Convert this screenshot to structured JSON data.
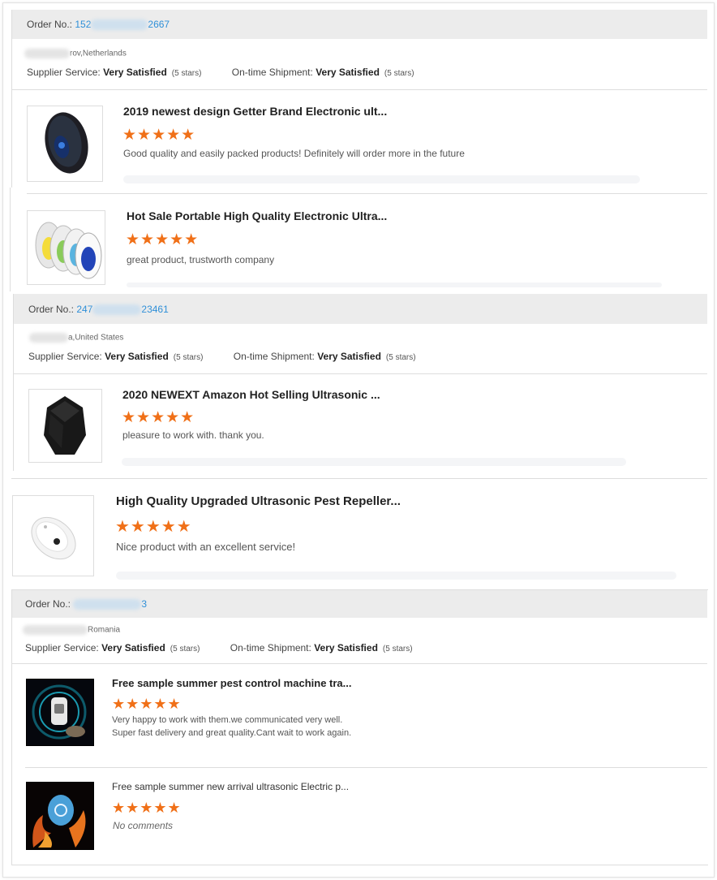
{
  "orders": [
    {
      "order_label": "Order No.:",
      "order_prefix": "152",
      "order_suffix": "2667",
      "location": "rov,Netherlands",
      "supplier_label": "Supplier Service:",
      "supplier_value": "Very Satisfied",
      "supplier_stars": "(5 stars)",
      "shipment_label": "On-time Shipment:",
      "shipment_value": "Very Satisfied",
      "shipment_stars": "(5 stars)",
      "products": [
        {
          "title": "2019 newest design Getter Brand Electronic ult...",
          "stars": "★★★★★",
          "comment": "Good quality and easily packed products! Definitely will order more in the future"
        },
        {
          "title": "Hot Sale Portable High Quality Electronic Ultra...",
          "stars": "★★★★★",
          "comment": "great product, trustworth company"
        }
      ]
    },
    {
      "order_label": "Order No.:",
      "order_prefix": "247",
      "order_suffix": "23461",
      "location": "a,United States",
      "supplier_label": "Supplier Service:",
      "supplier_value": "Very Satisfied",
      "supplier_stars": "(5 stars)",
      "shipment_label": "On-time Shipment:",
      "shipment_value": "Very Satisfied",
      "shipment_stars": "(5 stars)",
      "products": [
        {
          "title": "2020 NEWEXT Amazon Hot Selling Ultrasonic ...",
          "stars": "★★★★★",
          "comment": "pleasure to work with. thank you."
        },
        {
          "title": "High Quality Upgraded Ultrasonic Pest Repeller...",
          "stars": "★★★★★",
          "comment": "Nice product with an excellent service!"
        }
      ]
    },
    {
      "order_label": "Order No.:",
      "order_prefix": "",
      "order_suffix": "3",
      "location": "Romania",
      "supplier_label": "Supplier Service:",
      "supplier_value": "Very Satisfied",
      "supplier_stars": "(5 stars)",
      "shipment_label": "On-time Shipment:",
      "shipment_value": "Very Satisfied",
      "shipment_stars": "(5 stars)",
      "products": [
        {
          "title": "Free sample summer pest control machine tra...",
          "stars": "★★★★★",
          "comment": "Very happy to work with them.we communicated very well.",
          "comment2": "Super fast delivery and great quality.Cant wait to work again."
        },
        {
          "title": "Free sample summer new arrival ultrasonic Electric p...",
          "stars": "★★★★★",
          "comment": "No comments"
        }
      ]
    }
  ],
  "colors": {
    "order_number": "#2e8fd8",
    "stars": "#f07018",
    "header_bg": "#ececec"
  }
}
